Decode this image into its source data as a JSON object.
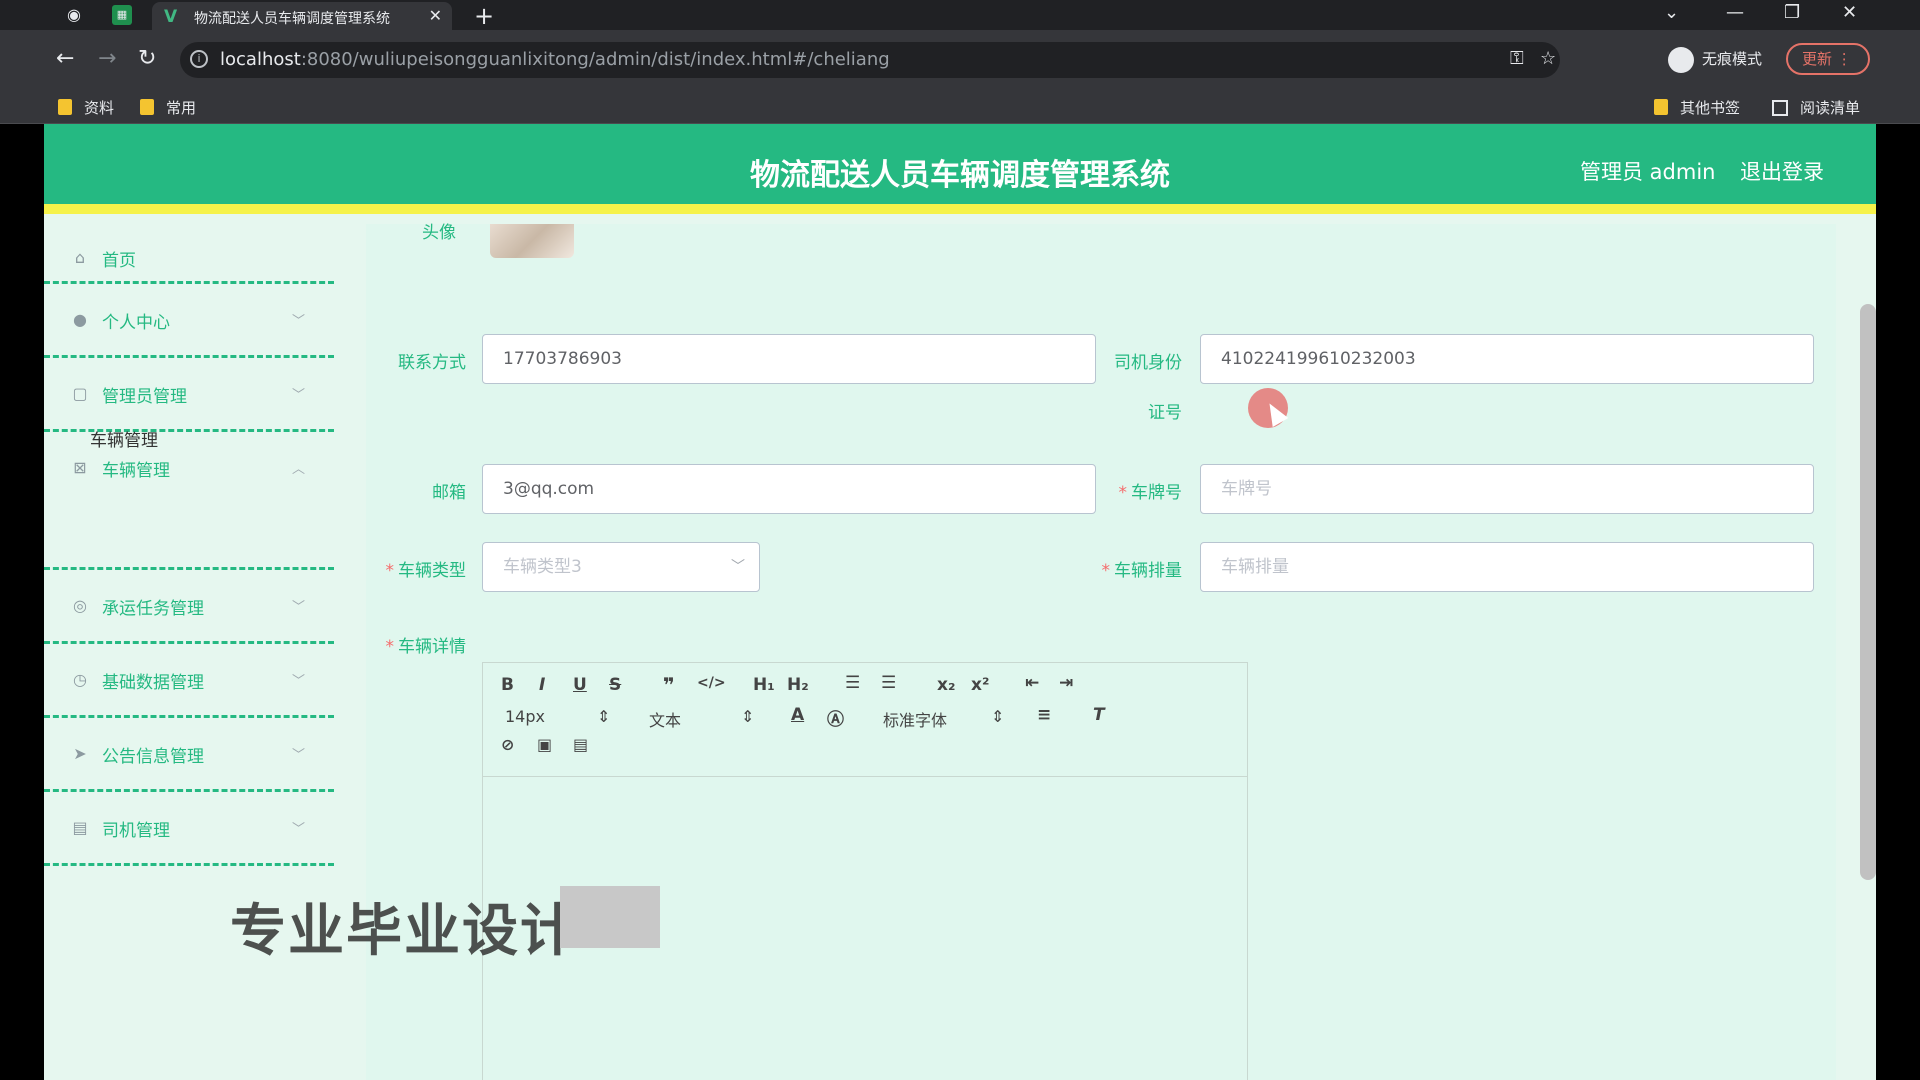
{
  "browser": {
    "tab_title": "物流配送人员车辆调度管理系统",
    "url_host": "localhost",
    "url_rest": ":8080/wuliupeisongguanlixitong/admin/dist/index.html#/cheliang",
    "profile": "无痕模式",
    "update": "更新",
    "bookmarks": [
      "资料",
      "常用"
    ],
    "other_bookmarks": "其他书签",
    "reading_list": "阅读清单"
  },
  "app": {
    "title": "物流配送人员车辆调度管理系统",
    "user": "管理员 admin",
    "logout": "退出登录",
    "accent": "#25b982",
    "header_bottom": "#f5f24a"
  },
  "sidebar": {
    "items": [
      {
        "label": "首页",
        "icon": "home-icon"
      },
      {
        "label": "个人中心",
        "icon": "user-icon"
      },
      {
        "label": "管理员管理",
        "icon": "admin-icon"
      },
      {
        "label": "车辆管理",
        "icon": "vehicle-icon"
      },
      {
        "label": "承运任务管理",
        "icon": "task-icon"
      },
      {
        "label": "基础数据管理",
        "icon": "data-icon"
      },
      {
        "label": "公告信息管理",
        "icon": "notice-icon"
      },
      {
        "label": "司机管理",
        "icon": "driver-icon"
      }
    ],
    "sub_item": "车辆管理"
  },
  "form": {
    "photo_label": "头像",
    "contact_label": "联系方式",
    "contact_value": "17703786903",
    "idcard_label_1": "司机身份",
    "idcard_label_2": "证号",
    "idcard_value": "410224199610232003",
    "email_label": "邮箱",
    "email_value": "3@qq.com",
    "plate_label": "车牌号",
    "plate_placeholder": "车牌号",
    "type_label": "车辆类型",
    "type_value": "车辆类型3",
    "disp_label": "车辆排量",
    "disp_placeholder": "车辆排量",
    "detail_label": "车辆详情"
  },
  "editor": {
    "font_size": "14px",
    "paragraph": "文本",
    "font_family": "标准字体"
  },
  "watermark": "专业毕业设计"
}
